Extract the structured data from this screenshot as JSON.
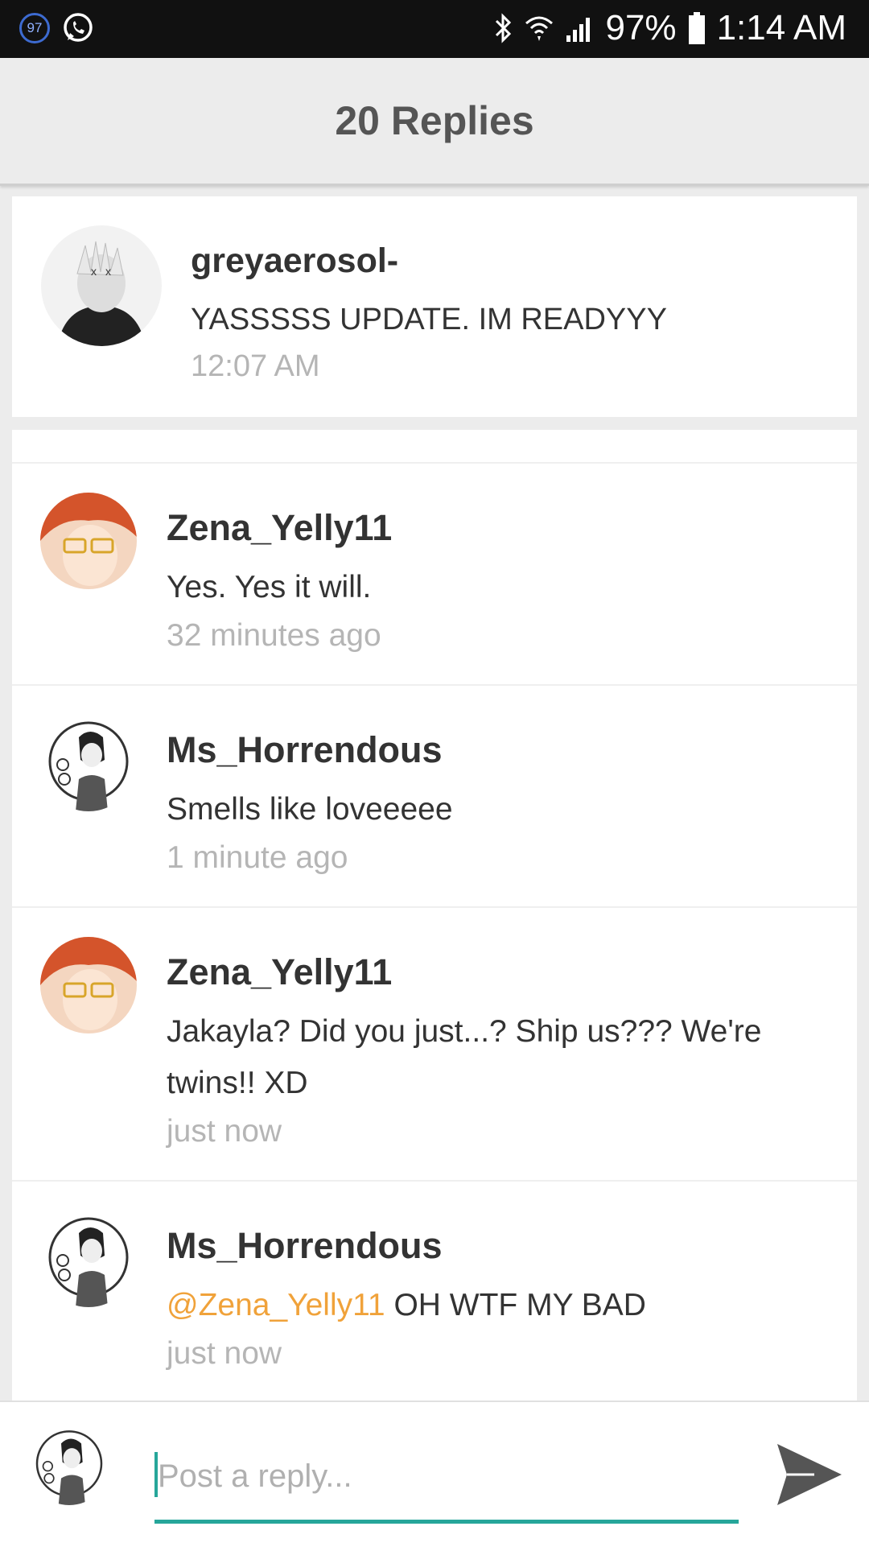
{
  "status_bar": {
    "notification_badge": "97",
    "battery": "97%",
    "time": "1:14 AM",
    "icons": [
      "whatsapp-icon",
      "bluetooth-icon",
      "wifi-icon",
      "signal-icon",
      "battery-icon"
    ]
  },
  "header": {
    "title": "20 Replies"
  },
  "original_post": {
    "username": "greyaerosol-",
    "text": "YASSSSS UPDATE. IM READYYY",
    "time": "12:07 AM"
  },
  "replies": [
    {
      "username": "Zena_Yelly11",
      "text": "Yes. Yes it will.",
      "time": "32 minutes ago"
    },
    {
      "username": "Ms_Horrendous",
      "text": "Smells like loveeeee",
      "time": "1 minute ago"
    },
    {
      "username": "Zena_Yelly11",
      "text": "Jakayla? Did you just...? Ship us??? We're twins!! XD",
      "time": "just now"
    },
    {
      "username": "Ms_Horrendous",
      "mention": "@Zena_Yelly11",
      "text": " OH WTF MY BAD",
      "time": "just now"
    }
  ],
  "composer": {
    "placeholder": "Post a reply..."
  },
  "colors": {
    "accent": "#26a69a",
    "mention": "#f0a23a",
    "muted": "#b5b5b5"
  }
}
